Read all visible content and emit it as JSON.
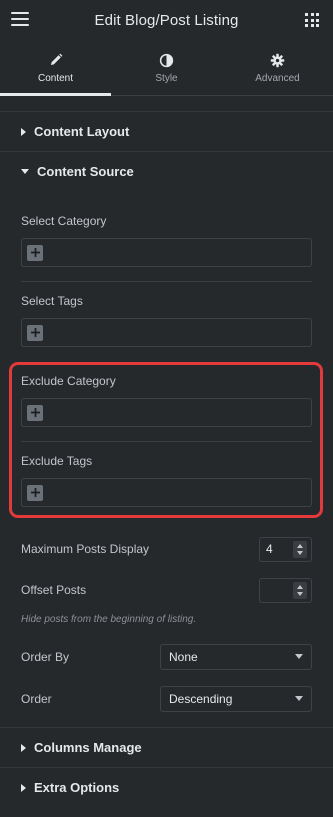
{
  "header": {
    "title": "Edit Blog/Post Listing",
    "menu_icon": "hamburger-icon",
    "apps_icon": "grid-icon"
  },
  "tabs": [
    {
      "label": "Content",
      "icon": "pencil-icon",
      "active": true
    },
    {
      "label": "Style",
      "icon": "half-circle-icon",
      "active": false
    },
    {
      "label": "Advanced",
      "icon": "gear-icon",
      "active": false
    }
  ],
  "sections": {
    "content_layout": "Content Layout",
    "content_source": "Content Source",
    "columns_manage": "Columns Manage",
    "extra_options": "Extra Options"
  },
  "fields": {
    "select_category": "Select Category",
    "select_tags": "Select Tags",
    "exclude_category": "Exclude Category",
    "exclude_tags": "Exclude Tags",
    "max_posts_label": "Maximum Posts Display",
    "max_posts_value": "4",
    "offset_label": "Offset Posts",
    "offset_value": "",
    "offset_hint": "Hide posts from the beginning of listing.",
    "order_by_label": "Order By",
    "order_by_value": "None",
    "order_label": "Order",
    "order_value": "Descending"
  },
  "colors": {
    "background": "#26292c",
    "highlight": "#e23a3a",
    "text": "#c2c6cb"
  }
}
